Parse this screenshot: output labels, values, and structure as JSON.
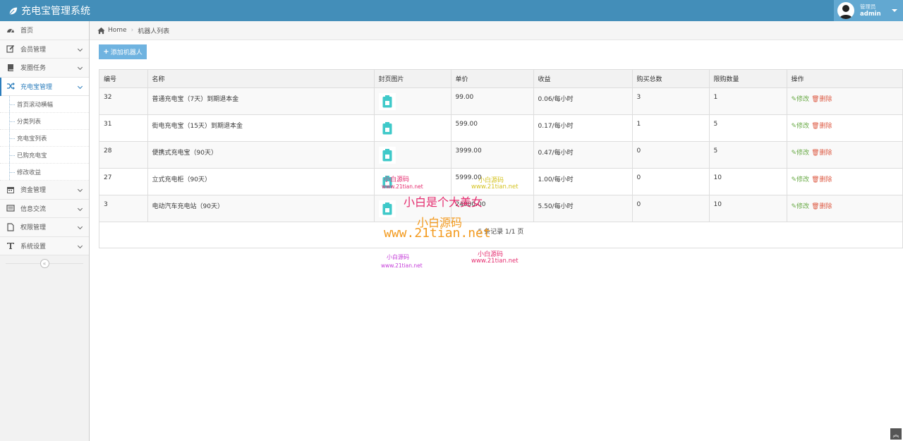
{
  "app": {
    "title": "充电宝管理系统"
  },
  "user": {
    "role": "管理员",
    "name": "admin"
  },
  "sidebar": {
    "items": [
      {
        "label": "首页",
        "icon": "dashboard-icon",
        "has_children": false
      },
      {
        "label": "会员管理",
        "icon": "edit-icon",
        "has_children": true
      },
      {
        "label": "发圈任务",
        "icon": "book-icon",
        "has_children": true
      },
      {
        "label": "充电宝管理",
        "icon": "random-icon",
        "has_children": true,
        "active": true
      }
    ],
    "sub_items": [
      "首页滚动横幅",
      "分类列表",
      "充电宝列表",
      "已购充电宝",
      "修改收益"
    ],
    "items_after": [
      {
        "label": "资金管理",
        "icon": "calendar-icon"
      },
      {
        "label": "信息交流",
        "icon": "message-icon"
      },
      {
        "label": "权限管理",
        "icon": "file-icon"
      },
      {
        "label": "系统设置",
        "icon": "text-icon"
      }
    ]
  },
  "breadcrumb": {
    "home": "Home",
    "current": "机器人列表"
  },
  "toolbar": {
    "add_label": "添加机器人"
  },
  "table": {
    "columns": [
      "编号",
      "名称",
      "封页图片",
      "单价",
      "收益",
      "购买总数",
      "限购数量",
      "操作"
    ],
    "rows": [
      {
        "id": "32",
        "name": "普通充电宝（7天）到期退本金",
        "price": "99.00",
        "income": "0.06/每小时",
        "total": "3",
        "limit": "1"
      },
      {
        "id": "31",
        "name": "街电充电宝（15天）到期退本金",
        "price": "599.00",
        "income": "0.17/每小时",
        "total": "1",
        "limit": "5"
      },
      {
        "id": "28",
        "name": "便携式充电宝（90天）",
        "price": "3999.00",
        "income": "0.47/每小时",
        "total": "0",
        "limit": "5"
      },
      {
        "id": "27",
        "name": "立式充电柜（90天）",
        "price": "5999.00",
        "income": "1.00/每小时",
        "total": "0",
        "limit": "10"
      },
      {
        "id": "3",
        "name": "电动汽车充电站（90天）",
        "price": "24000.00",
        "income": "5.50/每小时",
        "total": "0",
        "limit": "10"
      }
    ],
    "edit_label": "修改",
    "delete_label": "删除",
    "pagination": "5 条记录 1/1 页"
  },
  "watermark": {
    "line1": "小白源码",
    "line2": "www.21tian.net",
    "line3": "小白是个大美女",
    "line4": "小白源码",
    "line5": "www.21tian.net",
    "line6": "小白源码",
    "line7": "www.21tian.net",
    "line8": "小白源码",
    "line9": "www.21tian.net",
    "line10": "小白源码",
    "line11": "www.21tian.net"
  },
  "colors": {
    "navbar": "#438eb9",
    "accent": "#2b7dbc",
    "add_button": "#6fb3e0",
    "edit": "#69aa46",
    "delete": "#dd5a43",
    "thumb_icon": "#3fc9c9"
  }
}
